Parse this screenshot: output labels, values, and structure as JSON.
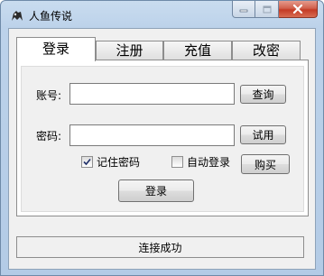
{
  "window": {
    "title": "人鱼传说"
  },
  "titlebar": {
    "icons": {
      "app": "mermaid-app-icon",
      "minimize": "minimize-icon",
      "maximize": "maximize-icon",
      "close": "close-icon"
    }
  },
  "tabs": [
    {
      "label": "登录",
      "active": true
    },
    {
      "label": "注册",
      "active": false
    },
    {
      "label": "充值",
      "active": false
    },
    {
      "label": "改密",
      "active": false
    }
  ],
  "login": {
    "account_label": "账号:",
    "account_value": "",
    "password_label": "密码:",
    "password_value": "",
    "query_button": "查询",
    "trial_button": "试用",
    "remember_password": {
      "label": "记住密码",
      "checked": true
    },
    "auto_login": {
      "label": "自动登录",
      "checked": false
    },
    "buy_button": "购买",
    "login_button": "登录"
  },
  "status": {
    "text": "连接成功"
  }
}
